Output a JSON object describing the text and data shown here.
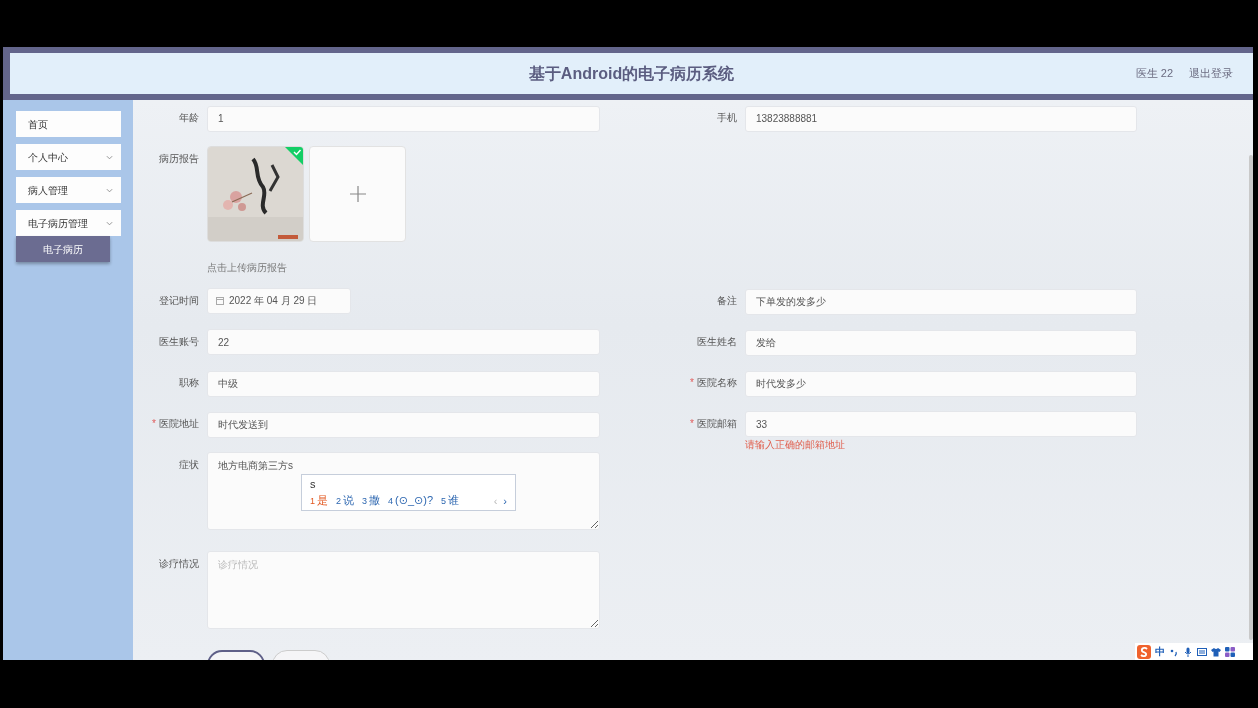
{
  "header": {
    "title": "基于Android的电子病历系统",
    "user": "医生 22",
    "logout": "退出登录"
  },
  "sidebar": {
    "items": [
      {
        "label": "首页",
        "kind": "link"
      },
      {
        "label": "个人中心",
        "kind": "group"
      },
      {
        "label": "病人管理",
        "kind": "group"
      },
      {
        "label": "电子病历管理",
        "kind": "group",
        "children": [
          {
            "label": "电子病历",
            "selected": true
          }
        ]
      }
    ]
  },
  "form": {
    "rows": [
      {
        "fields": [
          {
            "kind": "input",
            "label": "年龄",
            "value": "1"
          },
          {
            "kind": "input",
            "label": "手机",
            "value": "13823888881"
          }
        ]
      },
      {
        "fields": [
          {
            "kind": "upload",
            "label": "病历报告",
            "images": [
              {
                "kind": "picture",
                "uploaded": true
              }
            ],
            "hint": "点击上传病历报告"
          }
        ]
      },
      {
        "fields": [
          {
            "kind": "date",
            "label": "登记时间",
            "value": "2022 年 04 月 29 日"
          },
          {
            "kind": "input",
            "label": "备注",
            "value": "下单发的发多少"
          }
        ]
      },
      {
        "fields": [
          {
            "kind": "input",
            "label": "医生账号",
            "value": "22"
          },
          {
            "kind": "input",
            "label": "医生姓名",
            "value": "发给"
          }
        ]
      },
      {
        "fields": [
          {
            "kind": "input",
            "label": "职称",
            "value": "中级"
          },
          {
            "kind": "input",
            "label": "医院名称",
            "value": "时代发多少",
            "required_mark": "*"
          }
        ]
      },
      {
        "fields": [
          {
            "kind": "input",
            "label": "医院地址",
            "value": "时代发送到",
            "required_mark": "*"
          },
          {
            "kind": "input",
            "label": "医院邮箱",
            "value": "33",
            "required_mark": "*",
            "error": "请输入正确的邮箱地址"
          }
        ]
      },
      {
        "fields": [
          {
            "kind": "textarea",
            "label": "症状",
            "value": "地方电商第三方s"
          }
        ]
      },
      {
        "fields": [
          {
            "kind": "textarea",
            "label": "诊疗情况",
            "placeholder": "诊疗情况"
          }
        ]
      }
    ],
    "buttons": [
      {
        "kind": "primary"
      },
      {
        "kind": "default"
      }
    ]
  },
  "ime": {
    "composition": "s",
    "candidates": [
      {
        "index": "1",
        "text": "是",
        "selected": true
      },
      {
        "index": "2",
        "text": "说",
        "selected": false
      },
      {
        "index": "3",
        "text": "撒",
        "selected": false
      },
      {
        "index": "4",
        "text": "(⊙_⊙)?",
        "selected": false
      },
      {
        "index": "5",
        "text": "谁",
        "selected": false
      }
    ],
    "prev": "‹",
    "next": "›"
  },
  "tray": {
    "mode": "中"
  }
}
